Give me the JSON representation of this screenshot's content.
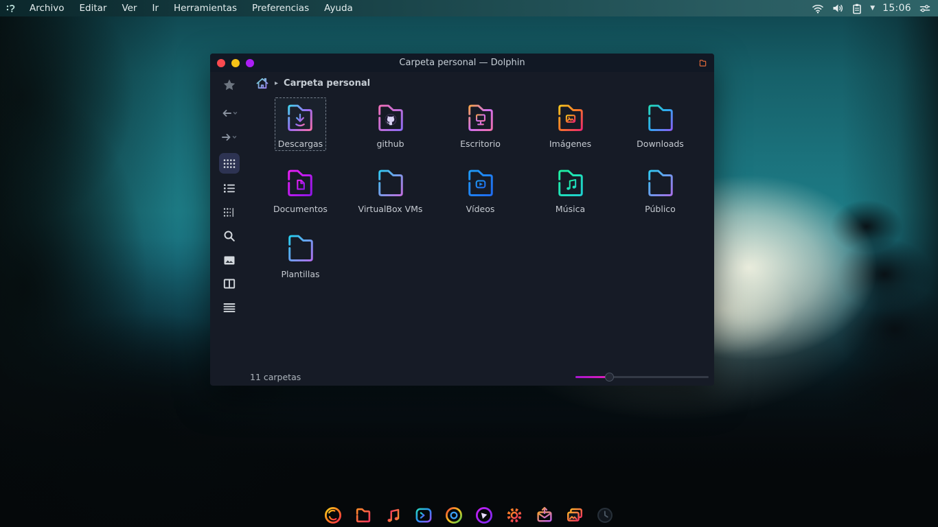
{
  "menubar": {
    "logo_icon": "distro-logo-icon",
    "menus": [
      "Archivo",
      "Editar",
      "Ver",
      "Ir",
      "Herramientas",
      "Preferencias",
      "Ayuda"
    ],
    "tray_icons": [
      "wifi",
      "volume",
      "clipboard",
      "dropdown-caret",
      "tune-sliders"
    ],
    "clock": "15:06"
  },
  "window": {
    "title": "Carpeta personal — Dolphin",
    "breadcrumb_root_icon": "home",
    "breadcrumb_current": "Carpeta personal",
    "traffic_lights": [
      {
        "name": "close",
        "color": "#fb4a4f"
      },
      {
        "name": "minimize",
        "color": "#f6c317"
      },
      {
        "name": "maximize",
        "color": "#ab1ef5"
      }
    ],
    "sidebar_tools": [
      "favorites",
      "back",
      "forward",
      "icons-view",
      "details-view",
      "compact-view",
      "search",
      "preview",
      "split-view",
      "menu"
    ],
    "active_view": "icons-view",
    "folders": [
      {
        "label": "Descargas",
        "glyph": "download",
        "from": "#45d4f0",
        "mid": "#9a6cf2",
        "to": "#f76fae",
        "selected": true
      },
      {
        "label": "github",
        "glyph": "github",
        "from": "#f06fb8",
        "to": "#8f6cf5"
      },
      {
        "label": "Escritorio",
        "glyph": "monitor",
        "from": "#f5a24a",
        "mid": "#cf6ff0",
        "to": "#f06fae"
      },
      {
        "label": "Imágenes",
        "glyph": "image",
        "from": "#f5c41f",
        "mid": "#f5762a",
        "to": "#f02a6e"
      },
      {
        "label": "Downloads",
        "glyph": null,
        "from": "#25d8b8",
        "mid": "#2fa8f0",
        "to": "#8a5ff5"
      },
      {
        "label": "Documentos",
        "glyph": "document",
        "from": "#e81ff5",
        "to": "#8f16e8"
      },
      {
        "label": "VirtualBox VMs",
        "glyph": null,
        "from": "#2fc8f0",
        "to": "#c06fe0"
      },
      {
        "label": "Vídeos",
        "glyph": "play",
        "from": "#1f9af5",
        "to": "#1f6bf0"
      },
      {
        "label": "Música",
        "glyph": "music",
        "from": "#1ff0a0",
        "to": "#1fd0d0"
      },
      {
        "label": "Público",
        "glyph": null,
        "from": "#2fc8f0",
        "to": "#a66fe8"
      },
      {
        "label": "Plantillas",
        "glyph": null,
        "from": "#25d0f0",
        "to": "#b06ff0"
      }
    ],
    "status_text": "11 carpetas",
    "zoom_slider_percent": 25,
    "accent_color": "#c21bd6"
  },
  "dock": {
    "items": [
      {
        "name": "firefox-browser",
        "icon": "firefox",
        "from": "#ffd21f",
        "mid": "#ff7a1f",
        "to": "#ff2a4e"
      },
      {
        "name": "file-manager",
        "icon": "folder",
        "from": "#ff8c2a",
        "to": "#f5365e"
      },
      {
        "name": "music-player",
        "icon": "music",
        "from": "#f5365e",
        "to": "#ff9d2a"
      },
      {
        "name": "terminal",
        "icon": "terminal",
        "from": "#2ad8c0",
        "mid": "#2a8cf0",
        "to": "#9a4ef5"
      },
      {
        "name": "chrome-browser",
        "icon": "chrome",
        "colors": [
          "#f54436",
          "#f5c41f",
          "#4fc84f"
        ],
        "accent": "#3aa0f5"
      },
      {
        "name": "media-player",
        "icon": "mpv",
        "from": "#c81ff5",
        "to": "#7a2af0"
      },
      {
        "name": "settings",
        "icon": "gear",
        "from": "#ff8c1f",
        "to": "#f5365e"
      },
      {
        "name": "mail-client",
        "icon": "mail",
        "from": "#f5a03a",
        "to": "#c05ff5"
      },
      {
        "name": "image-viewer",
        "icon": "gallery",
        "from": "#ffb02a",
        "to": "#f5365e"
      },
      {
        "name": "clock-app",
        "icon": "clock",
        "from": "#12171e",
        "to": "#242c35"
      }
    ]
  }
}
